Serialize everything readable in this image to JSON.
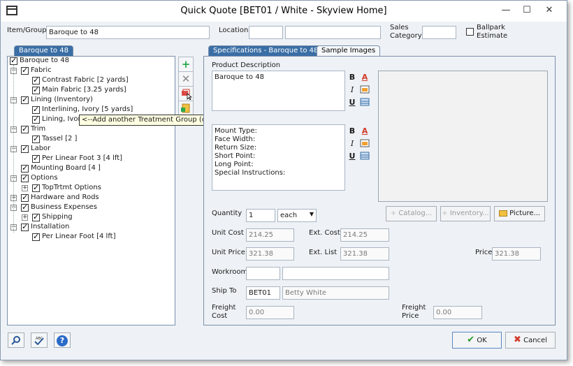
{
  "window": {
    "title": "Quick Quote [BET01 / White - Skyview Home]",
    "minimize": "—",
    "maximize": "☐",
    "close": "✕"
  },
  "header": {
    "item_group_label": "Item/Group",
    "item_group_value": "Baroque to  48",
    "location_label": "Location",
    "location_value": "",
    "location_desc": "",
    "sales_category_label": "Sales\nCategory",
    "sales_category_value": "",
    "ballpark_label": "Ballpark\nEstimate",
    "ballpark_checked": false
  },
  "tree": {
    "tab_label": "Baroque to  48",
    "root": "Baroque to  48",
    "nodes": [
      {
        "label": "Fabric",
        "level": 1,
        "expander": "−"
      },
      {
        "label": "Contrast Fabric [2 yards]",
        "level": 2
      },
      {
        "label": "Main Fabric [3.25 yards]",
        "level": 2
      },
      {
        "label": "Lining (Inventory)",
        "level": 1,
        "expander": "−"
      },
      {
        "label": "Interlining, Ivory [5 yards]",
        "level": 2
      },
      {
        "label": "Lining, Ivory",
        "level": 2
      },
      {
        "label": "Trim",
        "level": 1,
        "expander": "−"
      },
      {
        "label": "Tassel [2 ]",
        "level": 2
      },
      {
        "label": "Labor",
        "level": 1,
        "expander": "−"
      },
      {
        "label": "Per Linear Foot 3 [4 lft]",
        "level": 2
      },
      {
        "label": "Mounting Board [4 ]",
        "level": 1
      },
      {
        "label": "Options",
        "level": 1,
        "expander": "−"
      },
      {
        "label": "TopTrtmt Options",
        "level": 2,
        "expander": "+"
      },
      {
        "label": "Hardware and Rods",
        "level": 1,
        "expander": "+"
      },
      {
        "label": "Business Expenses",
        "level": 1,
        "expander": "−"
      },
      {
        "label": "Shipping",
        "level": 2,
        "expander": "+"
      },
      {
        "label": "Installation",
        "level": 1,
        "expander": "−"
      },
      {
        "label": "Per Linear Foot [4 lft]",
        "level": 2
      }
    ]
  },
  "side_buttons": {
    "add_icon": "plus-icon",
    "delete_icon": "x-icon",
    "add_group_icon": "add-group-icon",
    "copy_icon": "copy-icon"
  },
  "tooltip": "<--Add another Treatment Group (create Multilayered/Specialty Design)",
  "tabs": {
    "specifications": "Specifications - Baroque to  48",
    "sample_images": "Sample Images"
  },
  "spec": {
    "product_description_label": "Product Description",
    "product_description": "Baroque to  48",
    "notes": "Mount Type:\nFace Width:\nReturn Size:\nShort Point:\nLong Point:\nSpecial Instructions:",
    "bold": "B",
    "italic": "I",
    "underline": "U",
    "font_color": "A",
    "quantity_label": "Quantity",
    "quantity_value": "1",
    "unit_select": "each",
    "catalog_button": "Catalog...",
    "inventory_button": "Inventory...",
    "picture_button": "Picture...",
    "unit_cost_label": "Unit Cost",
    "unit_cost_value": "214.25",
    "ext_cost_label": "Ext. Cost",
    "ext_cost_value": "214.25",
    "unit_price_label": "Unit Price",
    "unit_price_value": "321.38",
    "ext_list_label": "Ext. List",
    "ext_list_value": "321.38",
    "price_label": "Price",
    "price_value": "321.38",
    "workroom_label": "Workroom",
    "workroom_code": "",
    "workroom_name": "",
    "ship_to_label": "Ship To",
    "ship_to_code": "BET01",
    "ship_to_name": "Betty White",
    "freight_cost_label": "Freight\nCost",
    "freight_cost_value": "0.00",
    "freight_price_label": "Freight\nPrice",
    "freight_price_value": "0.00"
  },
  "footer": {
    "ok_label": "OK",
    "cancel_label": "Cancel"
  },
  "colors": {
    "tab_active": "#3a6ea5",
    "ok_check": "#2a9a2a",
    "cancel_x": "#d23a2a",
    "add_green": "#2aa84a"
  }
}
